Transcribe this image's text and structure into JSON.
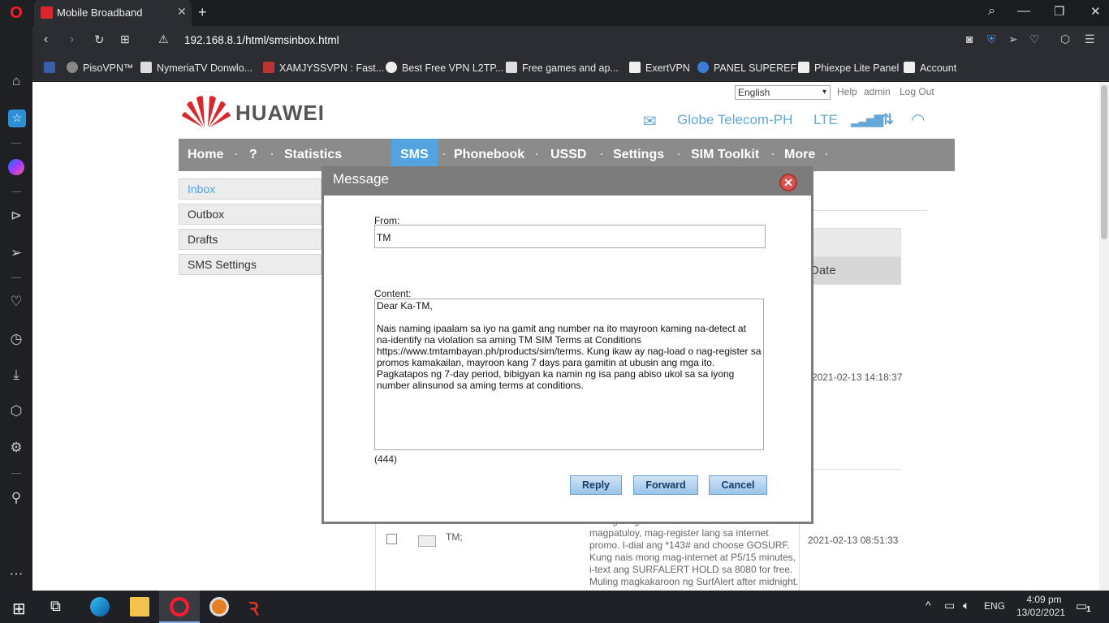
{
  "browser": {
    "tab_title": "Mobile Broadband",
    "url": "192.168.8.1/html/smsinbox.html",
    "bookmarks": [
      "PisoVPN™",
      "NymeriaTV Donwlo...",
      "XAMJYSSVPN : Fast...",
      "Best Free VPN L2TP...",
      "Free games and ap...",
      "ExertVPN",
      "PANEL SUPEREF",
      "Phiexpe Lite Panel",
      "Account"
    ]
  },
  "header": {
    "language": "English",
    "help": "Help",
    "user": "admin",
    "logout": "Log Out",
    "brand": "HUAWEI",
    "operator": "Globe Telecom-PH",
    "network_type": "LTE"
  },
  "nav": [
    "Home",
    "?",
    "Statistics",
    "SMS",
    "Phonebook",
    "USSD",
    "Settings",
    "SIM Toolkit",
    "More"
  ],
  "sms_menu": [
    "Inbox",
    "Outbox",
    "Drafts",
    "SMS Settings"
  ],
  "table": {
    "date_header": "Date",
    "row1_date": "2021-02-13 14:18:37",
    "row2_from": "TM;",
    "row2_content": "tawing mag to connect sa internet. Para magpatuloy, mag-register lang sa internet promo. I-dial ang *143# and choose GOSURF. Kung nais mong mag-internet at P5/15 minutes, i-text ang SURFALERT HOLD sa 8080 for free. Muling magkakaroon ng SurfAlert after midnight.",
    "row2_date": "2021-02-13 08:51:33"
  },
  "modal": {
    "title": "Message",
    "from_label": "From:",
    "from_value": "TM",
    "content_label": "Content:",
    "content_value": "Dear Ka-TM,\n\nNais naming ipaalam sa iyo na gamit ang number na ito mayroon kaming na-detect at na-identify na violation sa aming TM SIM Terms at Conditions https://www.tmtambayan.ph/products/sim/terms. Kung ikaw ay nag-load o nag-register sa promos kamakailan, mayroon kang 7 days para gamitin at ubusin ang mga ito. Pagkatapos ng 7-day period, bibigyan ka namin ng isa pang abiso ukol sa sa iyong number alinsunod sa aming terms at conditions.",
    "char_count": "(444)",
    "reply": "Reply",
    "forward": "Forward",
    "cancel": "Cancel"
  },
  "taskbar": {
    "lang": "ENG",
    "time": "4:09 pm",
    "date": "13/02/2021",
    "notifications": "1"
  }
}
